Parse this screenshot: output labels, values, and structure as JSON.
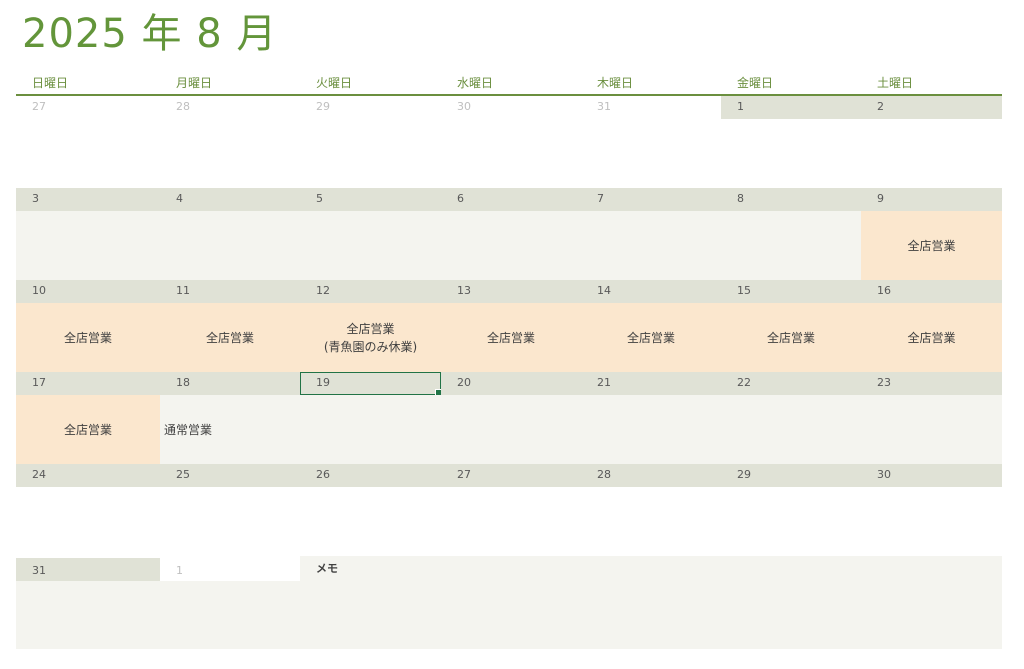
{
  "title": "2025 年 8 月",
  "weekdays": [
    "日曜日",
    "月曜日",
    "火曜日",
    "水曜日",
    "木曜日",
    "金曜日",
    "土曜日"
  ],
  "weeks": [
    {
      "days": [
        {
          "num": "27",
          "other_month": true
        },
        {
          "num": "28",
          "other_month": true
        },
        {
          "num": "29",
          "other_month": true
        },
        {
          "num": "30",
          "other_month": true
        },
        {
          "num": "31",
          "other_month": true
        },
        {
          "num": "1"
        },
        {
          "num": "2"
        }
      ],
      "events": [
        "",
        "",
        "",
        "",
        "",
        "",
        ""
      ]
    },
    {
      "days": [
        {
          "num": "3"
        },
        {
          "num": "4"
        },
        {
          "num": "5"
        },
        {
          "num": "6"
        },
        {
          "num": "7"
        },
        {
          "num": "8"
        },
        {
          "num": "9"
        }
      ],
      "events": [
        "",
        "",
        "",
        "",
        "",
        "",
        "全店営業"
      ]
    },
    {
      "days": [
        {
          "num": "10"
        },
        {
          "num": "11"
        },
        {
          "num": "12"
        },
        {
          "num": "13"
        },
        {
          "num": "14"
        },
        {
          "num": "15"
        },
        {
          "num": "16"
        }
      ],
      "events": [
        "全店営業",
        "全店営業",
        "全店営業\n(青魚園のみ休業)",
        "全店営業",
        "全店営業",
        "全店営業",
        "全店営業"
      ]
    },
    {
      "days": [
        {
          "num": "17"
        },
        {
          "num": "18"
        },
        {
          "num": "19",
          "selected": true
        },
        {
          "num": "20"
        },
        {
          "num": "21"
        },
        {
          "num": "22"
        },
        {
          "num": "23"
        }
      ],
      "events": [
        "全店営業",
        "通常営業",
        "",
        "",
        "",
        "",
        ""
      ]
    },
    {
      "days": [
        {
          "num": "24"
        },
        {
          "num": "25"
        },
        {
          "num": "26"
        },
        {
          "num": "27"
        },
        {
          "num": "28"
        },
        {
          "num": "29"
        },
        {
          "num": "30"
        }
      ],
      "events": [
        "",
        "",
        "",
        "",
        "",
        "",
        ""
      ]
    }
  ],
  "last_row": {
    "days": [
      {
        "num": "31"
      },
      {
        "num": "1",
        "other_month": true
      }
    ],
    "memo_label": "メモ"
  },
  "colors": {
    "accent": "#63953a",
    "header_line": "#6b8f3f",
    "date_band": "#e0e2d6",
    "event_band": "#f4f4ef",
    "event_highlight": "#fbe7ce",
    "selection": "#217346"
  }
}
